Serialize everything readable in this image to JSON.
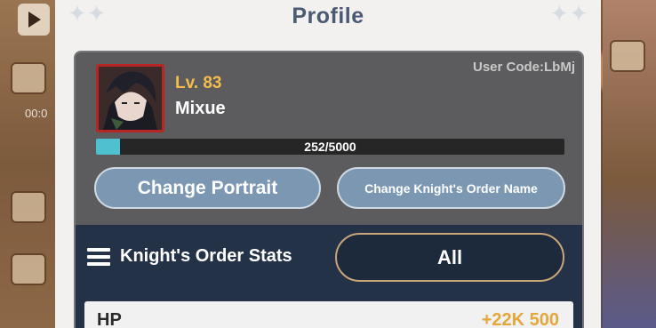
{
  "background": {
    "time_text": "00:0"
  },
  "modal": {
    "title": "Profile"
  },
  "profile": {
    "user_code": "User Code:LbMj",
    "level": "Lv. 83",
    "name": "Mixue",
    "xp_text": "252/5000",
    "xp_current": 252,
    "xp_max": 5000
  },
  "actions": {
    "change_portrait": "Change Portrait",
    "change_order_name": "Change Knight's Order Name"
  },
  "stats": {
    "title": "Knight's Order Stats",
    "filter_selected": "All",
    "rows": [
      {
        "label": "HP",
        "value": "+22K 500"
      }
    ]
  },
  "colors": {
    "title": "#4b5a73",
    "level": "#f3bd4a",
    "xp_fill": "#4fc0d0",
    "button": "#7c97b2",
    "stats_bg": "#233246",
    "stat_value": "#e3a73b",
    "portrait_frame": "#b82525"
  }
}
